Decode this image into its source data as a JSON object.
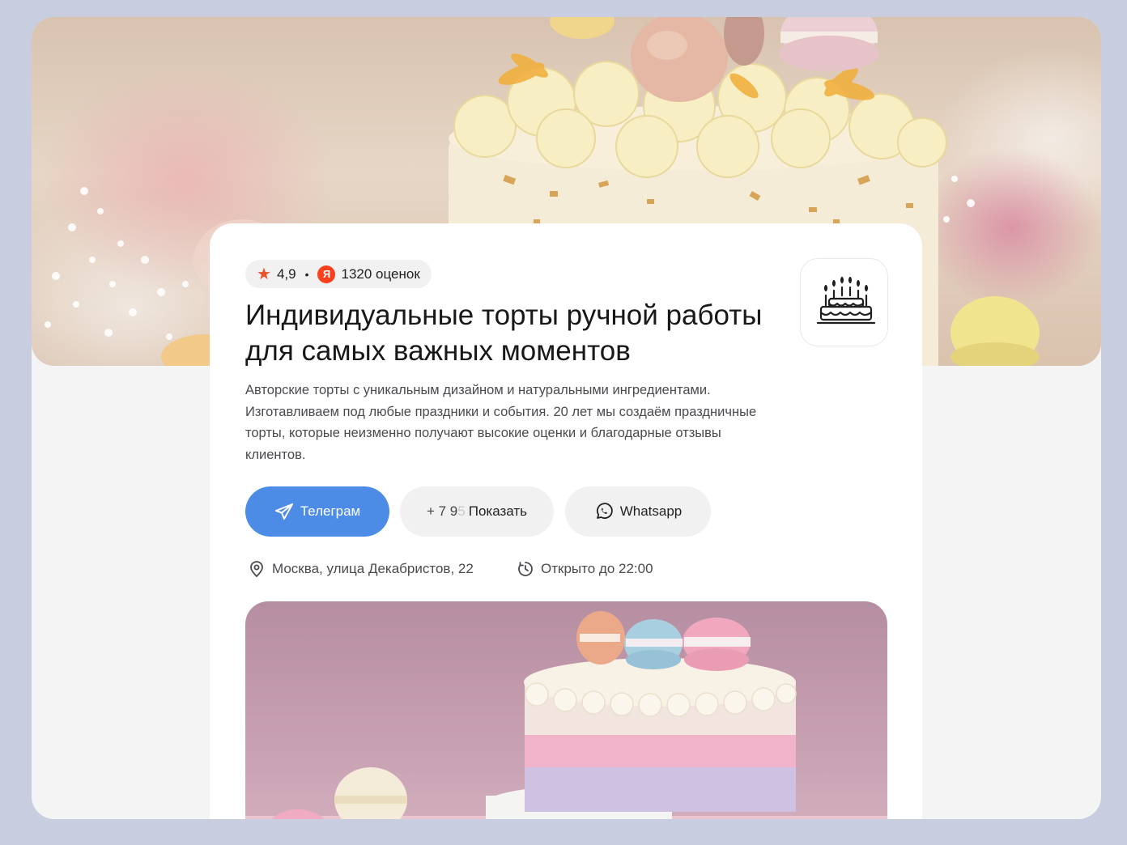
{
  "rating": {
    "score": "4,9",
    "separator": "•",
    "source_badge": "Я",
    "reviews_count": "1320 оценок"
  },
  "title": "Индивидуальные торты ручной работы для самых важных моментов",
  "description": "Авторские торты с уникальным дизайном и натуральными ингредиентами. Изготавливаем под любые праздники и события. 20 лет мы создаём праздничные торты, которые неизменно получают высокие оценки и благодарные отзывы клиентов.",
  "buttons": {
    "telegram": "Телеграм",
    "phone_prefix": "+ 7 9",
    "phone_hidden": "5",
    "phone_show": "Показать",
    "whatsapp": "Whatsapp"
  },
  "address": "Москва, улица Декабристов, 22",
  "hours": "Открыто до 22:00",
  "colors": {
    "accent": "#4c8ce6",
    "star": "#e8522c",
    "yandex": "#fc3f1d",
    "outer_bg": "#c8cde0"
  },
  "icons": [
    "star-icon",
    "yandex-icon",
    "cake-logo-icon",
    "telegram-icon",
    "whatsapp-icon",
    "location-pin-icon",
    "clock-icon"
  ]
}
